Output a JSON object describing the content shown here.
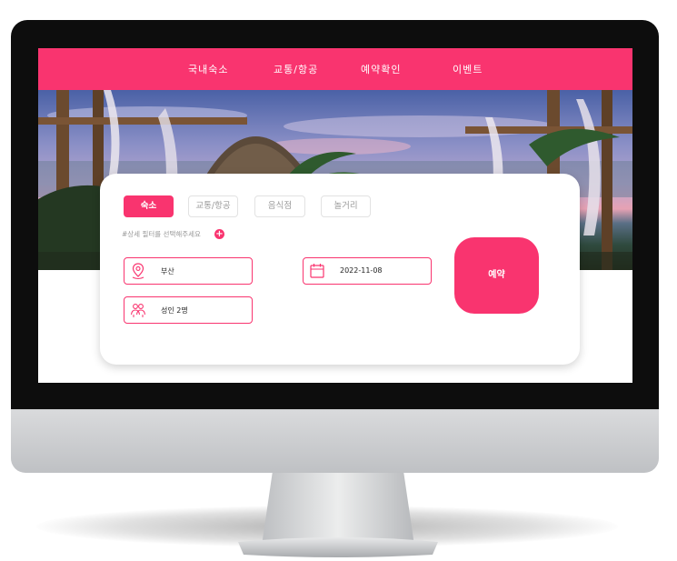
{
  "nav": {
    "items": [
      "국내숙소",
      "교통/항공",
      "예약확인",
      "이벤트"
    ]
  },
  "search": {
    "tabs": [
      "숙소",
      "교통/항공",
      "음식점",
      "놀거리"
    ],
    "active_tab": "숙소",
    "filter_hint": "#상세 필터를 선택해주세요",
    "location_value": "부산",
    "date_value": "2022-11-08",
    "guests_value": "성인 2명",
    "book_label": "예약"
  },
  "icons": {
    "location": "location-pin-icon",
    "date": "calendar-icon",
    "guests": "people-icon",
    "filter_add": "plus-icon"
  },
  "colors": {
    "accent": "#f9346f"
  }
}
